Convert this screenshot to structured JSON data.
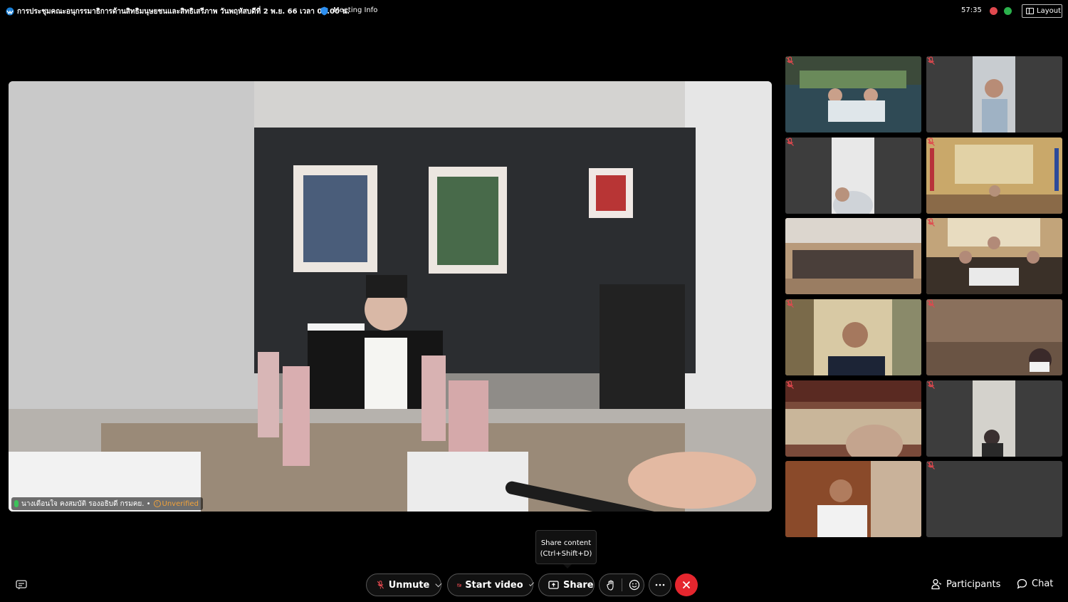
{
  "header": {
    "meeting_title": "การประชุมคณะอนุกรรมาธิการด้านสิทธิมนุษยชนและสิทธิเสรีภาพ วันพฤหัสบดีที่ 2 พ.ย. 66 เวลา 09.00 น.",
    "meeting_info_label": "Meeting Info",
    "timer": "57:35",
    "layout_label": "Layout"
  },
  "main_video": {
    "speaker_name": "นางเดือนใจ คงสมบัติ รองอธิบดี กรมคย. •",
    "unverified_label": "Unverified"
  },
  "tiles": [
    {
      "scene": "meeting-room-group",
      "muted": true
    },
    {
      "scene": "person-window",
      "muted": true
    },
    {
      "scene": "person-partial",
      "muted": true
    },
    {
      "scene": "formal-hall",
      "muted": true
    },
    {
      "scene": "empty-conference-room",
      "muted": false
    },
    {
      "scene": "meeting-table-flags",
      "muted": true
    },
    {
      "scene": "man-curtains",
      "muted": true
    },
    {
      "scene": "woman-masked",
      "muted": true
    },
    {
      "scene": "elderly-man",
      "muted": true
    },
    {
      "scene": "person-dim",
      "muted": true
    },
    {
      "scene": "man-white-shirt",
      "muted": false
    },
    {
      "scene": "blank",
      "muted": true
    }
  ],
  "tooltip": {
    "line1": "Share content",
    "line2": "(Ctrl+Shift+D)"
  },
  "controls": {
    "unmute_label": "Unmute",
    "start_video_label": "Start video",
    "share_label": "Share",
    "participants_label": "Participants",
    "chat_label": "Chat"
  },
  "colors": {
    "end_call": "#e5262e",
    "unverified": "#f2a33a",
    "mute_icon": "#e0484e"
  }
}
